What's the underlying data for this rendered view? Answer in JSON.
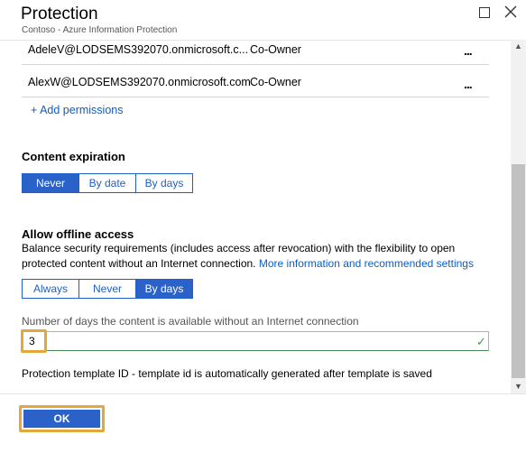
{
  "header": {
    "title": "Protection",
    "subtitle": "Contoso - Azure Information Protection"
  },
  "permissions": {
    "rows": [
      {
        "email": "AdeleV@LODSEMS392070.onmicrosoft.c...",
        "role": "Co-Owner",
        "more": "..."
      },
      {
        "email": "AlexW@LODSEMS392070.onmicrosoft.com",
        "role": "Co-Owner",
        "more": "..."
      }
    ],
    "add_label": "+ Add permissions"
  },
  "content_expiration": {
    "heading": "Content expiration",
    "options": [
      "Never",
      "By date",
      "By days"
    ],
    "selected": "Never"
  },
  "offline_access": {
    "heading": "Allow offline access",
    "description": "Balance security requirements (includes access after revocation) with the flexibility to open protected content without an Internet connection.",
    "link": "More information and recommended settings",
    "options": [
      "Always",
      "Never",
      "By days"
    ],
    "selected": "By days",
    "days_label": "Number of days the content is available without an Internet connection",
    "days_value": "3"
  },
  "template_id_text": "Protection template ID - template id is automatically generated after template is saved",
  "footer": {
    "ok_label": "OK"
  },
  "icons": {
    "maximize": "maximize-icon",
    "close": "close-icon",
    "check": "checkmark-icon",
    "accent": "#2a62c9",
    "link_color": "#0a5ec6",
    "highlight": "#e2a93a"
  }
}
